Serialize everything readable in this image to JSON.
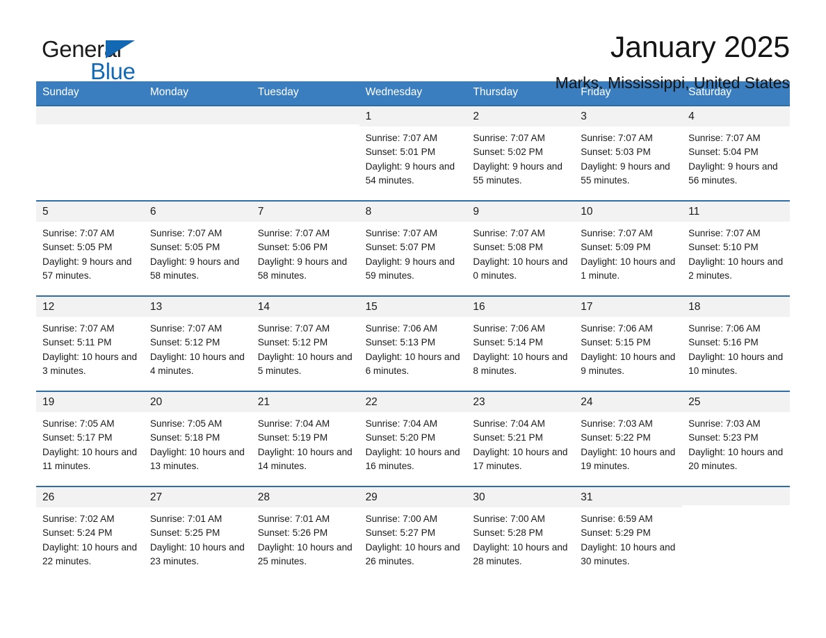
{
  "brand": {
    "name_part1": "General",
    "name_part2": "Blue",
    "accent_color": "#1268b3",
    "triangle_icon": "triangle-icon"
  },
  "header": {
    "title": "January 2025",
    "subtitle": "Marks, Mississippi, United States"
  },
  "calendar": {
    "header_bg": "#3a7ebf",
    "row_border": "#2e6da4",
    "daynum_bg": "#f2f2f2",
    "weekdays": [
      "Sunday",
      "Monday",
      "Tuesday",
      "Wednesday",
      "Thursday",
      "Friday",
      "Saturday"
    ],
    "weeks": [
      [
        {
          "day": "",
          "sunrise": "",
          "sunset": "",
          "daylight": ""
        },
        {
          "day": "",
          "sunrise": "",
          "sunset": "",
          "daylight": ""
        },
        {
          "day": "",
          "sunrise": "",
          "sunset": "",
          "daylight": ""
        },
        {
          "day": "1",
          "sunrise": "Sunrise: 7:07 AM",
          "sunset": "Sunset: 5:01 PM",
          "daylight": "Daylight: 9 hours and 54 minutes."
        },
        {
          "day": "2",
          "sunrise": "Sunrise: 7:07 AM",
          "sunset": "Sunset: 5:02 PM",
          "daylight": "Daylight: 9 hours and 55 minutes."
        },
        {
          "day": "3",
          "sunrise": "Sunrise: 7:07 AM",
          "sunset": "Sunset: 5:03 PM",
          "daylight": "Daylight: 9 hours and 55 minutes."
        },
        {
          "day": "4",
          "sunrise": "Sunrise: 7:07 AM",
          "sunset": "Sunset: 5:04 PM",
          "daylight": "Daylight: 9 hours and 56 minutes."
        }
      ],
      [
        {
          "day": "5",
          "sunrise": "Sunrise: 7:07 AM",
          "sunset": "Sunset: 5:05 PM",
          "daylight": "Daylight: 9 hours and 57 minutes."
        },
        {
          "day": "6",
          "sunrise": "Sunrise: 7:07 AM",
          "sunset": "Sunset: 5:05 PM",
          "daylight": "Daylight: 9 hours and 58 minutes."
        },
        {
          "day": "7",
          "sunrise": "Sunrise: 7:07 AM",
          "sunset": "Sunset: 5:06 PM",
          "daylight": "Daylight: 9 hours and 58 minutes."
        },
        {
          "day": "8",
          "sunrise": "Sunrise: 7:07 AM",
          "sunset": "Sunset: 5:07 PM",
          "daylight": "Daylight: 9 hours and 59 minutes."
        },
        {
          "day": "9",
          "sunrise": "Sunrise: 7:07 AM",
          "sunset": "Sunset: 5:08 PM",
          "daylight": "Daylight: 10 hours and 0 minutes."
        },
        {
          "day": "10",
          "sunrise": "Sunrise: 7:07 AM",
          "sunset": "Sunset: 5:09 PM",
          "daylight": "Daylight: 10 hours and 1 minute."
        },
        {
          "day": "11",
          "sunrise": "Sunrise: 7:07 AM",
          "sunset": "Sunset: 5:10 PM",
          "daylight": "Daylight: 10 hours and 2 minutes."
        }
      ],
      [
        {
          "day": "12",
          "sunrise": "Sunrise: 7:07 AM",
          "sunset": "Sunset: 5:11 PM",
          "daylight": "Daylight: 10 hours and 3 minutes."
        },
        {
          "day": "13",
          "sunrise": "Sunrise: 7:07 AM",
          "sunset": "Sunset: 5:12 PM",
          "daylight": "Daylight: 10 hours and 4 minutes."
        },
        {
          "day": "14",
          "sunrise": "Sunrise: 7:07 AM",
          "sunset": "Sunset: 5:12 PM",
          "daylight": "Daylight: 10 hours and 5 minutes."
        },
        {
          "day": "15",
          "sunrise": "Sunrise: 7:06 AM",
          "sunset": "Sunset: 5:13 PM",
          "daylight": "Daylight: 10 hours and 6 minutes."
        },
        {
          "day": "16",
          "sunrise": "Sunrise: 7:06 AM",
          "sunset": "Sunset: 5:14 PM",
          "daylight": "Daylight: 10 hours and 8 minutes."
        },
        {
          "day": "17",
          "sunrise": "Sunrise: 7:06 AM",
          "sunset": "Sunset: 5:15 PM",
          "daylight": "Daylight: 10 hours and 9 minutes."
        },
        {
          "day": "18",
          "sunrise": "Sunrise: 7:06 AM",
          "sunset": "Sunset: 5:16 PM",
          "daylight": "Daylight: 10 hours and 10 minutes."
        }
      ],
      [
        {
          "day": "19",
          "sunrise": "Sunrise: 7:05 AM",
          "sunset": "Sunset: 5:17 PM",
          "daylight": "Daylight: 10 hours and 11 minutes."
        },
        {
          "day": "20",
          "sunrise": "Sunrise: 7:05 AM",
          "sunset": "Sunset: 5:18 PM",
          "daylight": "Daylight: 10 hours and 13 minutes."
        },
        {
          "day": "21",
          "sunrise": "Sunrise: 7:04 AM",
          "sunset": "Sunset: 5:19 PM",
          "daylight": "Daylight: 10 hours and 14 minutes."
        },
        {
          "day": "22",
          "sunrise": "Sunrise: 7:04 AM",
          "sunset": "Sunset: 5:20 PM",
          "daylight": "Daylight: 10 hours and 16 minutes."
        },
        {
          "day": "23",
          "sunrise": "Sunrise: 7:04 AM",
          "sunset": "Sunset: 5:21 PM",
          "daylight": "Daylight: 10 hours and 17 minutes."
        },
        {
          "day": "24",
          "sunrise": "Sunrise: 7:03 AM",
          "sunset": "Sunset: 5:22 PM",
          "daylight": "Daylight: 10 hours and 19 minutes."
        },
        {
          "day": "25",
          "sunrise": "Sunrise: 7:03 AM",
          "sunset": "Sunset: 5:23 PM",
          "daylight": "Daylight: 10 hours and 20 minutes."
        }
      ],
      [
        {
          "day": "26",
          "sunrise": "Sunrise: 7:02 AM",
          "sunset": "Sunset: 5:24 PM",
          "daylight": "Daylight: 10 hours and 22 minutes."
        },
        {
          "day": "27",
          "sunrise": "Sunrise: 7:01 AM",
          "sunset": "Sunset: 5:25 PM",
          "daylight": "Daylight: 10 hours and 23 minutes."
        },
        {
          "day": "28",
          "sunrise": "Sunrise: 7:01 AM",
          "sunset": "Sunset: 5:26 PM",
          "daylight": "Daylight: 10 hours and 25 minutes."
        },
        {
          "day": "29",
          "sunrise": "Sunrise: 7:00 AM",
          "sunset": "Sunset: 5:27 PM",
          "daylight": "Daylight: 10 hours and 26 minutes."
        },
        {
          "day": "30",
          "sunrise": "Sunrise: 7:00 AM",
          "sunset": "Sunset: 5:28 PM",
          "daylight": "Daylight: 10 hours and 28 minutes."
        },
        {
          "day": "31",
          "sunrise": "Sunrise: 6:59 AM",
          "sunset": "Sunset: 5:29 PM",
          "daylight": "Daylight: 10 hours and 30 minutes."
        },
        {
          "day": "",
          "sunrise": "",
          "sunset": "",
          "daylight": ""
        }
      ]
    ]
  }
}
